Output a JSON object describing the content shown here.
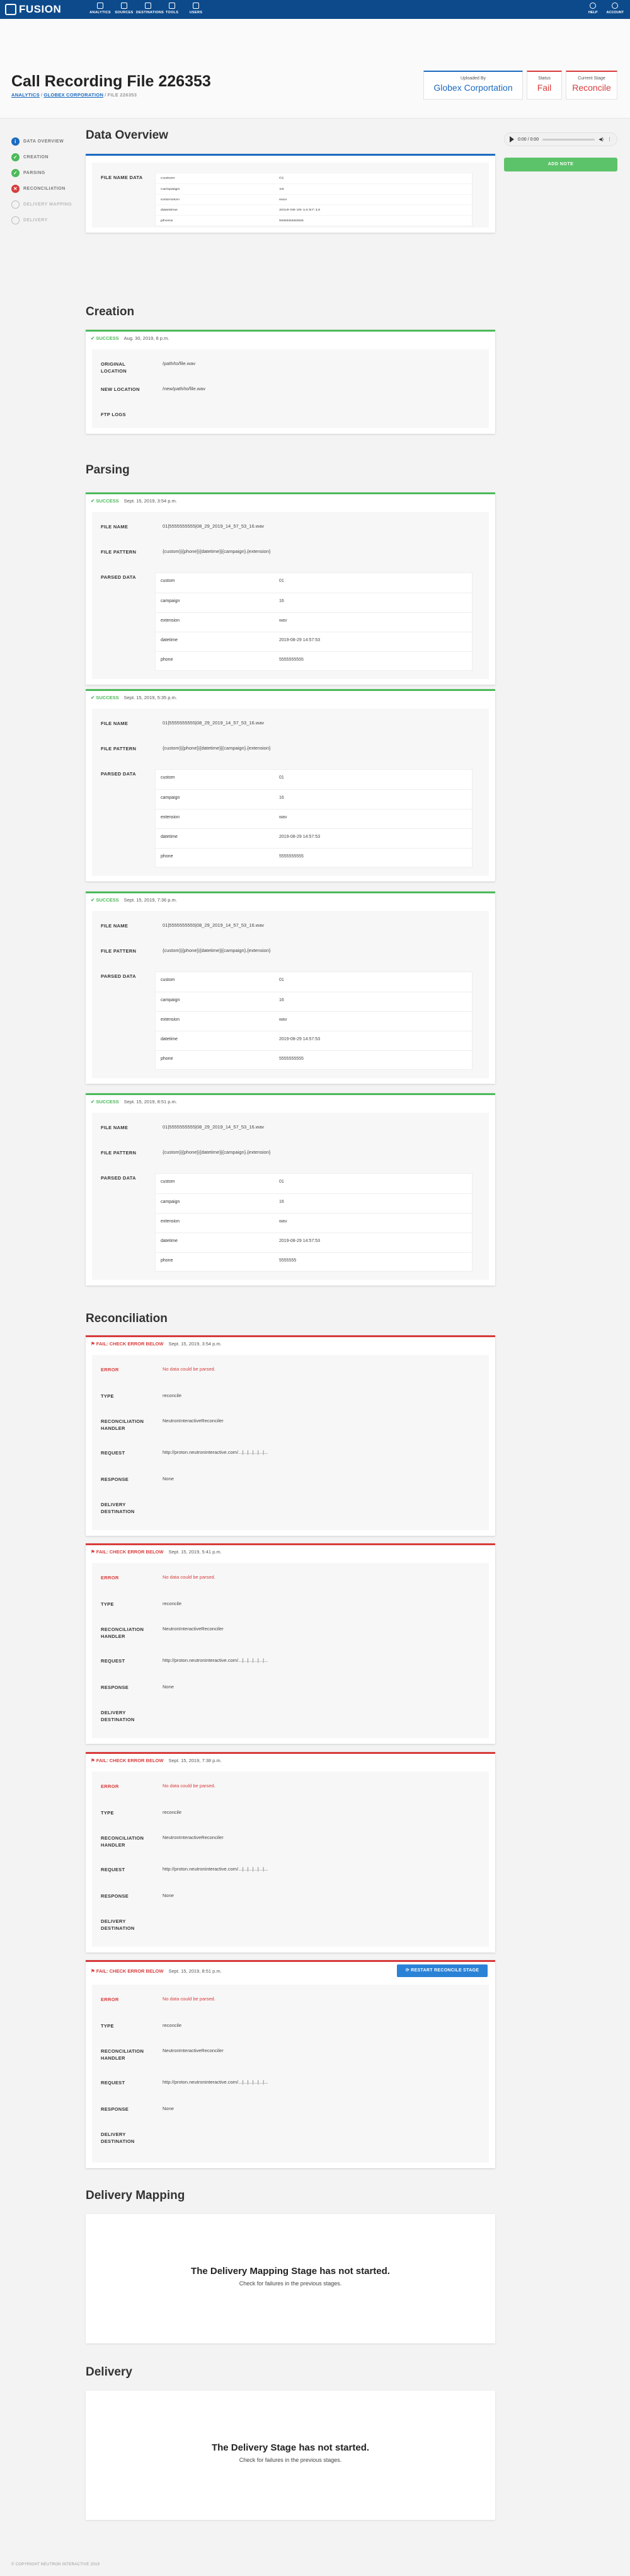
{
  "topbar": {
    "brand": "FUSION",
    "nav": [
      "ANALYTICS",
      "SOURCES",
      "DESTINATIONS",
      "TOOLS",
      "USERS"
    ],
    "right": [
      "HELP",
      "ACCOUNT"
    ]
  },
  "page": {
    "title": "Call Recording File 226353",
    "crumbs": [
      "ANALYTICS",
      "GLOBEX CORPORATION",
      "FILE 226353"
    ]
  },
  "info": {
    "uploaded_label": "Uploaded By",
    "uploaded_value": "Globex Corportation",
    "status_label": "Status",
    "status_value": "Fail",
    "stage_label": "Current Stage",
    "stage_value": "Reconcile"
  },
  "sidenav": [
    "DATA OVERVIEW",
    "CREATION",
    "PARSING",
    "RECONCILIATION",
    "DELIVERY MAPPING",
    "DELIVERY"
  ],
  "audio": {
    "time": "0:00 / 0:00"
  },
  "add_note": "ADD NOTE",
  "sections": {
    "overview": "Data Overview",
    "creation": "Creation",
    "parsing": "Parsing",
    "reconciliation": "Reconciliation",
    "delivery_mapping": "Delivery Mapping",
    "delivery": "Delivery"
  },
  "labels": {
    "file_name_data": "FILE NAME DATA",
    "original_location": "ORIGINAL LOCATION",
    "new_location": "NEW LOCATION",
    "ftp_logs": "FTP LOGS",
    "file_name": "FILE NAME",
    "file_pattern": "FILE PATTERN",
    "parsed_data": "PARSED DATA",
    "error": "ERROR",
    "type": "TYPE",
    "handler": "RECONCILIATION HANDLER",
    "request": "REQUEST",
    "response": "RESPONSE",
    "delivery_destination": "DELIVERY DESTINATION",
    "success": "✔ SUCCESS",
    "fail": "⚑ FAIL: CHECK ERROR BELOW"
  },
  "overview_table": [
    [
      "custom",
      "01"
    ],
    [
      "campaign",
      "16"
    ],
    [
      "extension",
      "wav"
    ],
    [
      "datetime",
      "2019-08-29 14:57:13"
    ],
    [
      "phone",
      "5555555555"
    ]
  ],
  "creation": {
    "date": "Aug. 30, 2019, 8 p.m.",
    "original_location": "/path/to/file.wav",
    "new_location": "/new/path/to/file.wav",
    "ftp_logs": ""
  },
  "parsing": [
    {
      "date": "Sept. 15, 2019, 3:54 p.m.",
      "file_name": "01|5555555555|08_29_2019_14_57_53_16.wav",
      "pattern": "{custom}|{phone}|{datetime}|{campaign}.{extension}",
      "table": [
        [
          "custom",
          "01"
        ],
        [
          "campaign",
          "16"
        ],
        [
          "extension",
          "wav"
        ],
        [
          "datetime",
          "2019-08-29 14:57:53"
        ],
        [
          "phone",
          "5555555555"
        ]
      ]
    },
    {
      "date": "Sept. 15, 2019, 5:35 p.m.",
      "file_name": "01|5555555555|08_29_2019_14_57_53_16.wav",
      "pattern": "{custom}|{phone}|{datetime}|{campaign}.{extension}",
      "table": [
        [
          "custom",
          "01"
        ],
        [
          "campaign",
          "16"
        ],
        [
          "extension",
          "wav"
        ],
        [
          "datetime",
          "2019-08-29 14:57:53"
        ],
        [
          "phone",
          "5555555555"
        ]
      ]
    },
    {
      "date": "Sept. 15, 2019, 7:36 p.m.",
      "file_name": "01|5555555555|08_29_2019_14_57_53_16.wav",
      "pattern": "{custom}|{phone}|{datetime}|{campaign}.{extension}",
      "table": [
        [
          "custom",
          "01"
        ],
        [
          "campaign",
          "16"
        ],
        [
          "extension",
          "wav"
        ],
        [
          "datetime",
          "2019-08-29 14:57:53"
        ],
        [
          "phone",
          "5555555555"
        ]
      ]
    },
    {
      "date": "Sept. 15, 2019, 8:51 p.m.",
      "file_name": "01|5555555555|08_29_2019_14_57_53_16.wav",
      "pattern": "{custom}|{phone}|{datetime}|{campaign}.{extension}",
      "table": [
        [
          "custom",
          "01"
        ],
        [
          "campaign",
          "16"
        ],
        [
          "extension",
          "wav"
        ],
        [
          "datetime",
          "2019-08-29 14:57:53"
        ],
        [
          "phone",
          "5555555"
        ]
      ]
    }
  ],
  "reconciliation": [
    {
      "date": "Sept. 15, 2019, 3:54 p.m.",
      "error": "No data could be parsed.",
      "type": "reconcile",
      "handler": "NeutronInteractiveReconciler",
      "request": "http://proton.neutroninteractive.com/...|...|...|...|...|...",
      "response": "None",
      "destination": ""
    },
    {
      "date": "Sept. 15, 2019, 5:41 p.m.",
      "error": "No data could be parsed.",
      "type": "reconcile",
      "handler": "NeutronInteractiveReconciler",
      "request": "http://proton.neutroninteractive.com/...|...|...|...|...|...",
      "response": "None",
      "destination": ""
    },
    {
      "date": "Sept. 15, 2019, 7:38 p.m.",
      "error": "No data could be parsed.",
      "type": "reconcile",
      "handler": "NeutronInteractiveReconciler",
      "request": "http://proton.neutroninteractive.com/...|...|...|...|...|...",
      "response": "None",
      "destination": ""
    },
    {
      "date": "Sept. 15, 2019, 8:51 p.m.",
      "error": "No data could be parsed.",
      "type": "reconcile",
      "handler": "NeutronInteractiveReconciler",
      "request": "http://proton.neutroninteractive.com/...|...|...|...|...|...",
      "response": "None",
      "destination": ""
    }
  ],
  "restart_label": "⟳ RESTART RECONCILE STAGE",
  "empty": {
    "mapping_title": "The Delivery Mapping Stage has not started.",
    "delivery_title": "The Delivery Stage has not started.",
    "subtitle": "Check for failures in the previous stages."
  },
  "footer": "© COPYRIGHT NEUTRON INTERACTIVE 2019"
}
